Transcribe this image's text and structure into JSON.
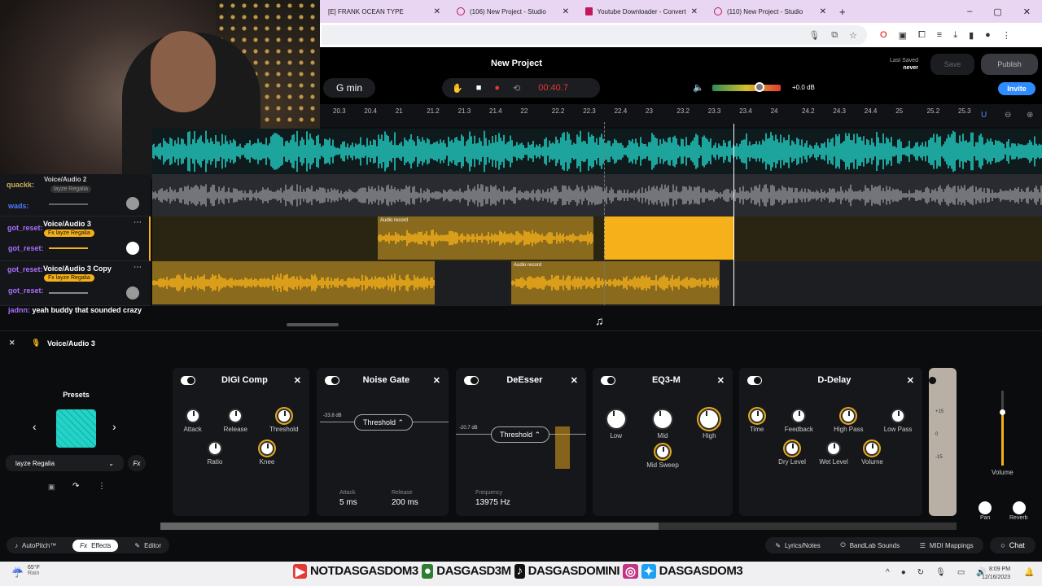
{
  "browser": {
    "tabs": [
      {
        "label": "[E] FRANK OCEAN TYPE"
      },
      {
        "label": "(106) New Project - Studio"
      },
      {
        "label": "Youtube Downloader - Convert"
      },
      {
        "label": "(110) New Project - Studio"
      }
    ],
    "new_tab": "+",
    "controls": [
      "–",
      "▢",
      "✕"
    ]
  },
  "header": {
    "project_title": "New Project",
    "key": "G min",
    "time": "00:40.7",
    "volume_db": "+0.0 dB",
    "last_saved_label": "Last Saved",
    "last_saved_value": "never",
    "save": "Save",
    "publish": "Publish",
    "invite": "Invite"
  },
  "ruler": [
    "20.3",
    "20.4",
    "21",
    "21.2",
    "21.3",
    "21.4",
    "22",
    "22.2",
    "22.3",
    "22.4",
    "23",
    "23.2",
    "23.3",
    "23.4",
    "24",
    "24.2",
    "24.3",
    "24.4",
    "25",
    "25.2",
    "25.3"
  ],
  "tracks": [
    {
      "name": "Voice/Audio 2",
      "fx": "layze Regalia"
    },
    {
      "name": "Voice/Audio 3",
      "fx": "Fx layze Regalia"
    },
    {
      "name": "Voice/Audio 3 Copy",
      "fx": "Fx layze Regalia"
    }
  ],
  "clips": {
    "label": "Audio record"
  },
  "chat": [
    {
      "user": "quackk:",
      "msg": ""
    },
    {
      "user": "wads:",
      "msg": ""
    },
    {
      "user": "got_reset:",
      "msg": ""
    },
    {
      "user": "got_reset:",
      "msg": ""
    },
    {
      "user": "got_reset:",
      "msg": ""
    },
    {
      "user": "got_reset:",
      "msg": ""
    },
    {
      "user": "jadnn:",
      "msg": "yeah buddy that sounded crazy"
    }
  ],
  "fx_bar": {
    "track": "Voice/Audio 3",
    "close": "✕"
  },
  "presets": {
    "title": "Presets",
    "selected": "layze Regalia",
    "fx": "Fx"
  },
  "effects": [
    {
      "name": "DIGI Comp",
      "knobs": [
        "Attack",
        "Release",
        "Threshold",
        "Ratio",
        "Knee"
      ]
    },
    {
      "name": "Noise Gate",
      "level": "-33.8 dB",
      "mode": "Threshold",
      "attack_label": "Attack",
      "attack": "5 ms",
      "release_label": "Release",
      "release": "200 ms"
    },
    {
      "name": "DeEsser",
      "level": "-20.7 dB",
      "mode": "Threshold",
      "freq_label": "Frequency",
      "freq": "13975 Hz"
    },
    {
      "name": "EQ3-M",
      "knobs": [
        "Low",
        "Mid",
        "High",
        "Mid Sweep"
      ]
    },
    {
      "name": "D-Delay",
      "knobs": [
        "Time",
        "Feedback",
        "High Pass",
        "Low Pass",
        "Dry Level",
        "Wet Level",
        "Volume"
      ]
    }
  ],
  "tape": {
    "scale": [
      "+15",
      "0",
      "-15"
    ]
  },
  "mixer": {
    "volume": "Volume",
    "pan": "Pan",
    "reverb": "Reverb"
  },
  "bottom": {
    "autopitch": "AutoPitch™",
    "effects": "Effects",
    "editor": "Editor",
    "lyrics": "Lyrics/Notes",
    "sounds": "BandLab Sounds",
    "midi": "MIDI Mappings",
    "chat": "Chat"
  },
  "taskbar": {
    "temp": "65°F",
    "weather": "Rain",
    "time": "8:09 PM",
    "date": "12/16/2023",
    "overlay": [
      "NOTDASGASDOM3",
      "DASGASD3M",
      "DASGASDOMINI",
      "DASGASDOM3"
    ]
  },
  "colors": {
    "accent": "#f5b01a",
    "cyan": "#22d3c8",
    "record": "#e53935",
    "invite": "#2f8cff"
  }
}
